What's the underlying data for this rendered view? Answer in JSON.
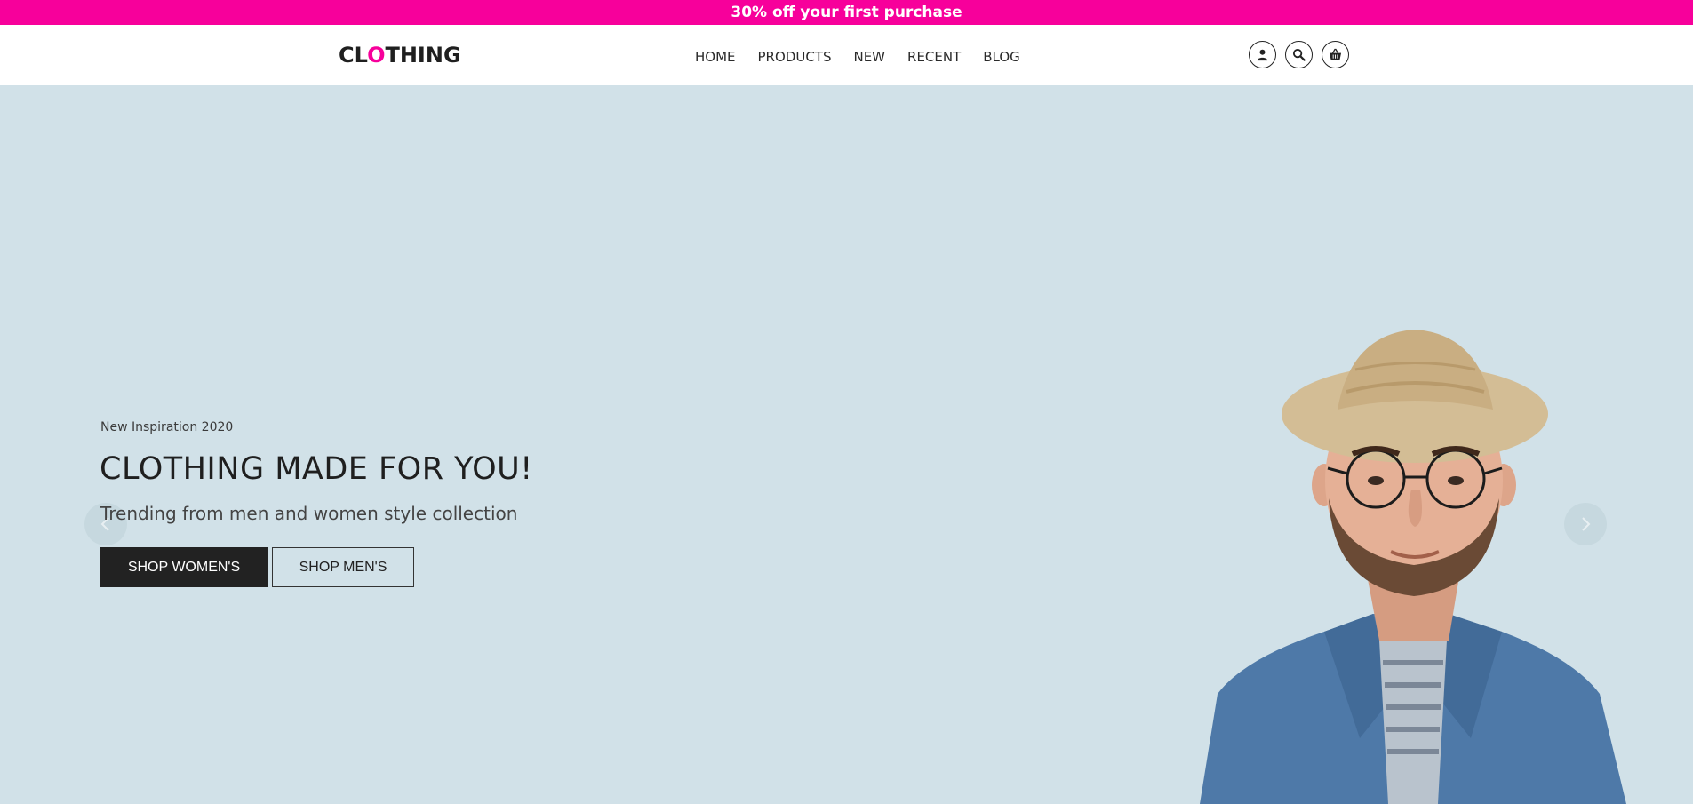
{
  "promo": {
    "text": "30% off your first purchase"
  },
  "header": {
    "logo": {
      "part1": "CL",
      "accent": "O",
      "part2": "THING"
    },
    "nav": [
      "HOME",
      "PRODUCTS",
      "NEW",
      "RECENT",
      "BLOG"
    ],
    "icons": [
      "user-icon",
      "search-icon",
      "basket-icon"
    ]
  },
  "hero": {
    "eyebrow": "New Inspiration 2020",
    "headline": "CLOTHING MADE FOR YOU!",
    "subline": "Trending from men and women style collection",
    "primary_button": "SHOP WOMEN'S",
    "secondary_button": "SHOP MEN'S"
  },
  "colors": {
    "brand": "#f7009b",
    "hero_bg": "#d1e1e8",
    "dark": "#222222"
  }
}
